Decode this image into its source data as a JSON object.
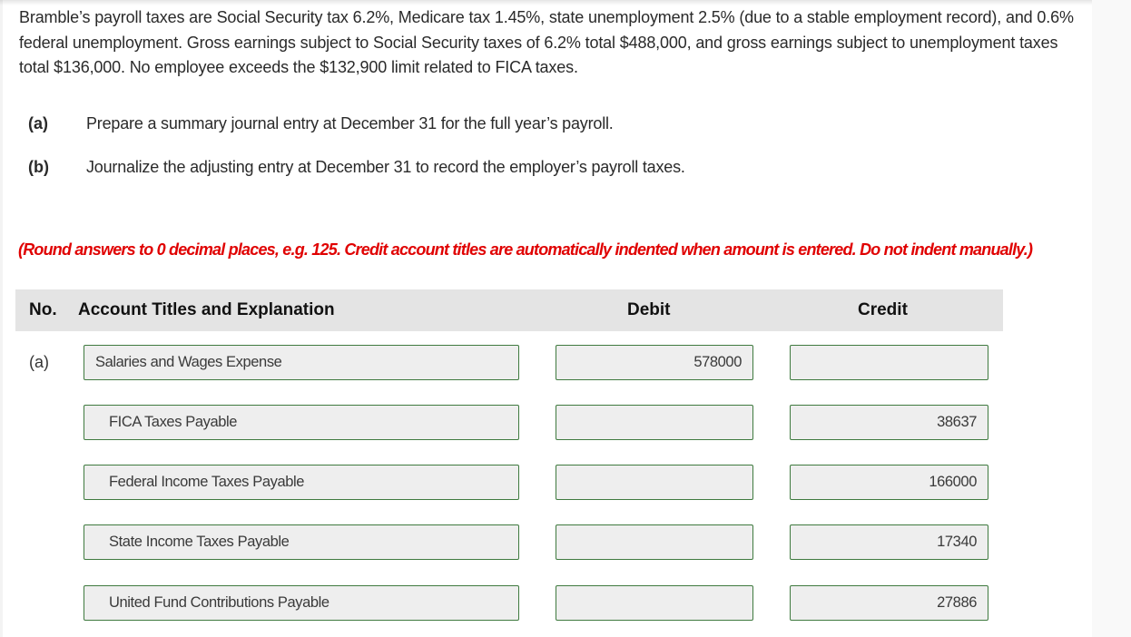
{
  "problem_text": "Bramble’s payroll taxes are Social Security tax 6.2%, Medicare tax 1.45%, state unemployment 2.5% (due to a stable employment record), and 0.6% federal unemployment. Gross earnings subject to Social Security taxes of 6.2% total $488,000, and gross earnings subject to unemployment taxes total $136,000. No employee exceeds the $132,900 limit related to FICA taxes.",
  "parts": [
    {
      "label": "(a)",
      "text": "Prepare a summary journal entry at December 31 for the full year’s payroll."
    },
    {
      "label": "(b)",
      "text": "Journalize the adjusting entry at December 31 to record the employer’s payroll taxes."
    }
  ],
  "instruction": "(Round answers to 0 decimal places, e.g. 125. Credit account titles are automatically indented when amount is entered. Do not indent manually.)",
  "table": {
    "headers": {
      "no": "No.",
      "account": "Account Titles and Explanation",
      "debit": "Debit",
      "credit": "Credit"
    },
    "rows": [
      {
        "no": "(a)",
        "account": "Salaries and Wages Expense",
        "debit": "578000",
        "credit": ""
      },
      {
        "no": "",
        "account": "FICA Taxes Payable",
        "debit": "",
        "credit": "38637"
      },
      {
        "no": "",
        "account": "Federal Income Taxes Payable",
        "debit": "",
        "credit": "166000"
      },
      {
        "no": "",
        "account": "State Income Taxes Payable",
        "debit": "",
        "credit": "17340"
      },
      {
        "no": "",
        "account": "United Fund Contributions Payable",
        "debit": "",
        "credit": "27886"
      }
    ]
  },
  "colors": {
    "field_border": "#3f7a3f",
    "field_bg": "#eeeeee",
    "header_bg": "#e4e4e4",
    "instruction": "#e00000"
  }
}
